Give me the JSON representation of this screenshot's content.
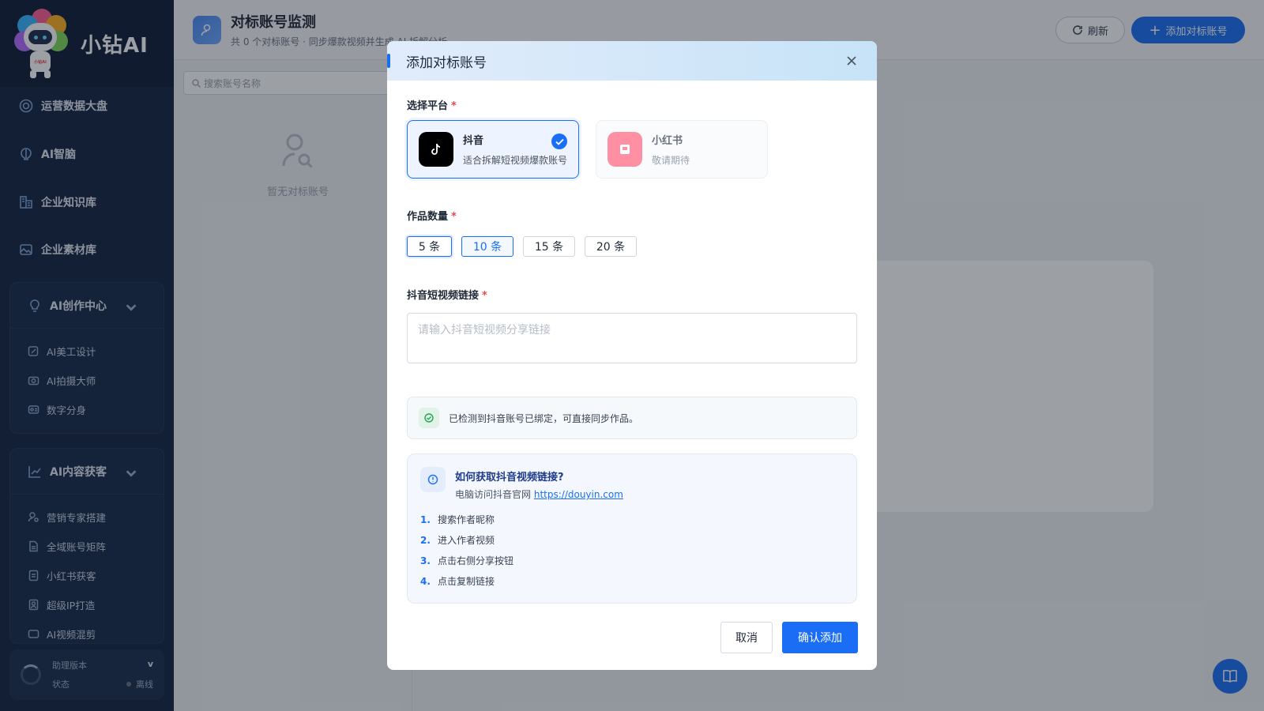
{
  "brand": {
    "name": "小钻AI",
    "logo_text": "小钻AI"
  },
  "sidebar": {
    "items": [
      {
        "label": "运营数据大盘",
        "icon": "dashboard-icon"
      },
      {
        "label": "AI智脑",
        "icon": "brain-icon"
      },
      {
        "label": "企业知识库",
        "icon": "library-icon"
      },
      {
        "label": "企业素材库",
        "icon": "image-icon"
      }
    ],
    "groups": [
      {
        "label": "AI创作中心",
        "icon": "bulb-icon",
        "items": [
          {
            "label": "AI美工设计"
          },
          {
            "label": "AI拍摄大师"
          },
          {
            "label": "数字分身"
          }
        ]
      },
      {
        "label": "AI内容获客",
        "icon": "chart-icon",
        "items": [
          {
            "label": "营销专家搭建"
          },
          {
            "label": "全域账号矩阵"
          },
          {
            "label": "小红书获客"
          },
          {
            "label": "超级IP打造"
          },
          {
            "label": "AI视频混剪"
          }
        ]
      }
    ],
    "status": {
      "version_label": "助理版本",
      "version_value": "v",
      "state_label": "状态",
      "state_value": "离线",
      "state_color": "#6b7280"
    }
  },
  "header": {
    "title": "对标账号监测",
    "subtitle": "共 0 个对标账号 · 同步爆款视频并生成 AI 拆解分析",
    "refresh_label": "刷新",
    "add_label": "添加对标账号"
  },
  "left_panel": {
    "search_placeholder": "搜索账号名称",
    "empty_text": "暂无对标账号"
  },
  "modal": {
    "title": "添加对标账号",
    "platform_label": "选择平台",
    "platforms": [
      {
        "name": "抖音",
        "desc": "适合拆解短视频爆款账号",
        "selected": true
      },
      {
        "name": "小红书",
        "desc": "敬请期待",
        "selected": false
      }
    ],
    "count_label": "作品数量",
    "counts": [
      "5 条",
      "10 条",
      "15 条",
      "20 条"
    ],
    "selected_count": "10 条",
    "link_label": "抖音短视频链接",
    "link_placeholder": "请输入抖音短视频分享链接",
    "notice": "已检测到抖音账号已绑定，可直接同步作品。",
    "howto": {
      "title": "如何获取抖音视频链接?",
      "desc": "电脑访问抖音官网",
      "link": "https://douyin.com",
      "steps": [
        {
          "num": "1.",
          "text": "搜索作者昵称"
        },
        {
          "num": "2.",
          "text": "进入作者视频"
        },
        {
          "num": "3.",
          "text": "点击右侧分享按钮"
        },
        {
          "num": "4.",
          "text": "点击复制链接"
        }
      ]
    },
    "cancel_label": "取消",
    "confirm_label": "确认添加"
  },
  "colors": {
    "accent": "#1a6ef5",
    "sidebar_bg": "#13233f",
    "required": "#e5484d"
  }
}
